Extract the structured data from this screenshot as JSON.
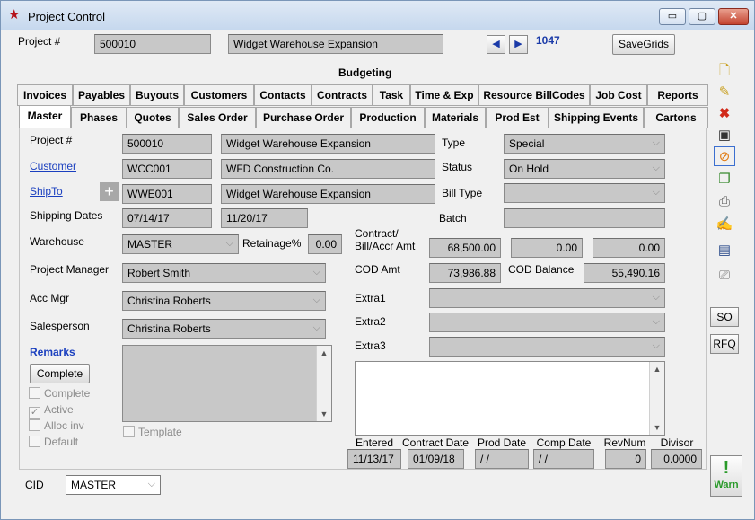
{
  "window": {
    "title": "Project Control",
    "minimize_label": "▭",
    "restore_label": "▢",
    "close_label": "✕"
  },
  "header": {
    "project_label": "Project #",
    "project_number": "500010",
    "project_name": "Widget Warehouse Expansion",
    "record_count": "1047",
    "save_grids_label": "SaveGrids",
    "section_title": "Budgeting"
  },
  "tabs_row1": [
    "Invoices",
    "Payables",
    "Buyouts",
    "Customers",
    "Contacts",
    "Contracts",
    "Task",
    "Time & Exp",
    "Resource BillCodes",
    "Job Cost",
    "Reports"
  ],
  "tabs_row2": [
    "Master",
    "Phases",
    "Quotes",
    "Sales Order",
    "Purchase Order",
    "Production",
    "Materials",
    "Prod Est",
    "Shipping Events",
    "Cartons"
  ],
  "master": {
    "project_label": "Project #",
    "project_number": "500010",
    "project_name": "Widget Warehouse Expansion",
    "customer_label": "Customer",
    "customer_code": "WCC001",
    "customer_name": "WFD Construction Co.",
    "shipto_label": "ShipTo",
    "shipto_code": "WWE001",
    "shipto_name": "Widget Warehouse Expansion",
    "shipping_dates_label": "Shipping Dates",
    "ship_start": "07/14/17",
    "ship_end": "11/20/17",
    "warehouse_label": "Warehouse",
    "warehouse": "MASTER",
    "retainage_label": "Retainage%",
    "retainage": "0.00",
    "pm_label": "Project Manager",
    "pm": "Robert Smith",
    "acc_mgr_label": "Acc Mgr",
    "acc_mgr": "Christina Roberts",
    "salesperson_label": "Salesperson",
    "salesperson": "Christina Roberts",
    "remarks_label": "Remarks",
    "complete_button": "Complete",
    "checks": {
      "complete": "Complete",
      "active": "Active",
      "alloc_inv": "Alloc inv",
      "default": "Default",
      "template": "Template"
    },
    "type_label": "Type",
    "type": "Special",
    "status_label": "Status",
    "status": "On Hold",
    "bill_type_label": "Bill Type",
    "bill_type": "",
    "batch_label": "Batch",
    "batch": "",
    "contract_label_1": "Contract/",
    "contract_label_2": "Bill/Accr Amt",
    "contract_amt": "68,500.00",
    "bill_amt": "0.00",
    "accr_amt": "0.00",
    "cod_amt_label": "COD Amt",
    "cod_amt": "73,986.88",
    "cod_balance_label": "COD Balance",
    "cod_balance": "55,490.16",
    "extra1_label": "Extra1",
    "extra2_label": "Extra2",
    "extra3_label": "Extra3",
    "entered_label": "Entered",
    "entered": "11/13/17",
    "contract_date_label": "Contract Date",
    "contract_date": "01/09/18",
    "prod_date_label": "Prod Date",
    "prod_date": " / /",
    "comp_date_label": "Comp Date",
    "comp_date": " / /",
    "revnum_label": "RevNum",
    "revnum": "0",
    "divisor_label": "Divisor",
    "divisor": "0.0000"
  },
  "footer": {
    "cid_label": "CID",
    "cid": "MASTER"
  },
  "sidebar": {
    "so_label": "SO",
    "rfq_label": "RFQ",
    "warn_label": "Warn"
  }
}
